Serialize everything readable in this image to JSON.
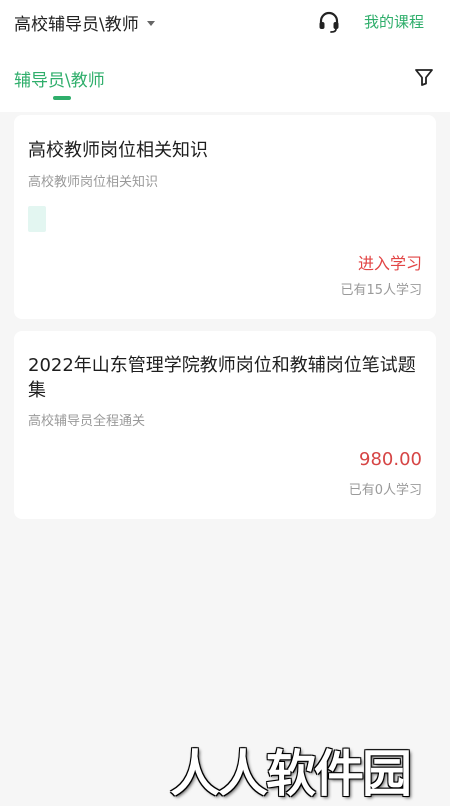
{
  "header": {
    "category_label": "高校辅导员\\教师",
    "my_courses_label": "我的课程",
    "support_icon": "headset-icon",
    "dropdown_icon": "caret-down-icon"
  },
  "tabs": [
    {
      "label": "辅导员\\教师",
      "active": true
    }
  ],
  "filter_icon": "filter-icon",
  "courses": [
    {
      "title": "高校教师岗位相关知识",
      "subtitle": "高校教师岗位相关知识",
      "action": "进入学习",
      "learners": "已有15人学习"
    },
    {
      "title": "2022年山东管理学院教师岗位和教辅岗位笔试题集",
      "subtitle": "高校辅导员全程通关",
      "price": "980.00",
      "learners": "已有0人学习"
    }
  ],
  "watermark": "人人软件园",
  "colors": {
    "accent": "#2fae6b",
    "price": "#d64545",
    "action": "#e24545",
    "background": "#f6f6f6"
  }
}
